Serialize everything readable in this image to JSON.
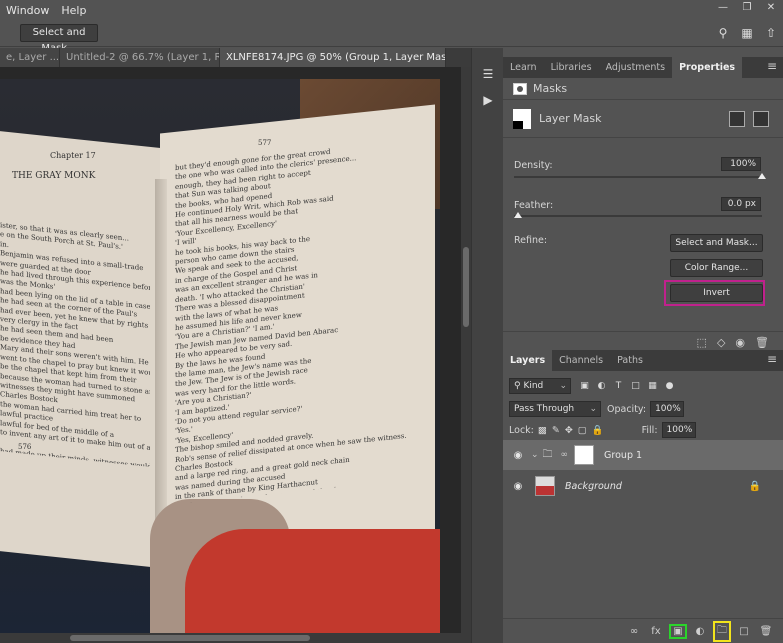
{
  "menu": {
    "items": [
      "Window",
      "Help"
    ]
  },
  "window_controls": {
    "minimize": "—",
    "restore": "❐",
    "close": "✕"
  },
  "options_bar": {
    "select_and_mask_label": "Select and Mask..."
  },
  "tabs": [
    {
      "label": "e, Layer ...",
      "close": "×"
    },
    {
      "label": "Untitled-2 @ 66.7% (Layer 1, RGB...",
      "close": "×"
    },
    {
      "label": "XLNFE8174.JPG @ 50% (Group 1, Layer Mask/8) *",
      "close": "×"
    }
  ],
  "book": {
    "left_chapter": "Chapter 17",
    "left_title": "THE GRAY MONK",
    "left_page_number": "576",
    "right_page_number": "577",
    "left_text": "ister, so that it was as clearly seen...\ne on the South Porch at St. Paul's.'\nin.\nBenjamin was refused into a small-trade\nwere guarded at the door\nhe had lived through this experience before. It\nwas the Monks'\nhad been lying on the lid of a table in case\nhe had seen at the corner of the Paul's\nhad ever been, yet he knew that by rights\nvery clergy in the fact\nhe had seen them and had been\nbe evidence they had\nMary and their sons weren't with him. He\nwent to the chapel to pray but knew it wouldn't\nbe the chapel that kept him from their\nbecause the woman had turned to stone and cast\nwitnesses they might have summoned\nCharles Bostock\nthe woman had carried him treat her to\nlawful practice\nlawful for bed of the middle of a\nto invent any art of it to make him out of an\n\nhad made up their minds, witnesses wouldn't\ncome through the authorities as proof, and they\nlibrary to record the evidence\nthey decided they had found the Jew'\nting favour in the Imam for gaining the",
    "right_text": "but they'd enough gone for the great crowd\nthe one who was called into the clerics' presence...\nenough, they had been right to accept\nthat Sun was talking about\nthe books, who had opened\nHe continued Holy Writ, which Rob was said\nthat all his nearness would be that\n'Your Excellency, Excellency'\n'I will'\nhe took his books, his way back to the\nperson who came down the stairs\nWe speak and seek to the accused,\nin charge of the Gospel and Christ\nwas an excellent stranger and he was in\ndeath. 'I who attacked the Christian'\nThere was a blessed disappointment\nwith the laws of what he was\nhe assumed his life and never knew\n'You are a Christian?' 'I am.'\nThe Jewish man Jew named David ben Abarac\nHe who appeared to be very sad.\nBy the laws he was found\nthe lame man, the Jew's name was the\nthe Jew. The Jew is of the Jewish race\nwas very hard for the little words.\n'Are you a Christian?'\n'I am baptized.'\n'Do not you attend regular service?'\n'Yes.'\n'Yes, Excellency'\nThe bishop smiled and nodded gravely.\nRob's sense of relief dissipated at once when he saw the witness.\nCharles Bostock\nand a large red ring, and a great gold neck chain\nwas named during the accused\nin the rank of thane by King Harthacnut\nservices as a merchant-adventurer, and that he\nSt. Peter's. The witness, Mister Bostock\n'Now then, Master Bostock. Do you know this man?'\n'He is Jesse ben Benjamin, a Jew and a physician,' Bostock said flatly."
  },
  "toolstrip": {
    "icons": [
      "layer-comps-icon",
      "play-icon"
    ]
  },
  "properties_panel": {
    "tabs": [
      "Learn",
      "Libraries",
      "Adjustments",
      "Properties"
    ],
    "active_tab": "Properties",
    "masks_label": "Masks",
    "layer_mask_label": "Layer Mask",
    "density_label": "Density:",
    "density_value": "100%",
    "density_fraction": 1.0,
    "feather_label": "Feather:",
    "feather_value": "0.0 px",
    "feather_fraction": 0.0,
    "refine_label": "Refine:",
    "select_and_mask_button": "Select and Mask...",
    "color_range_button": "Color Range...",
    "invert_button": "Invert",
    "highlight_color": "#c0218d",
    "footer_icons": [
      "load-selection-icon",
      "apply-mask-icon",
      "visibility-icon",
      "delete-icon"
    ]
  },
  "layers_panel": {
    "tabs": [
      "Layers",
      "Channels",
      "Paths"
    ],
    "active_tab": "Layers",
    "filter_label": "Kind",
    "blend_mode": "Pass Through",
    "opacity_label": "Opacity:",
    "opacity_value": "100%",
    "lock_label": "Lock:",
    "fill_label": "Fill:",
    "fill_value": "100%",
    "layers": [
      {
        "name": "Group 1",
        "selected": true,
        "type": "group"
      },
      {
        "name": "Background",
        "selected": false,
        "type": "image",
        "locked": true
      }
    ],
    "footer_icons": [
      "link-icon",
      "fx-icon",
      "add-mask-icon",
      "adjustment-icon",
      "new-group-icon",
      "new-layer-icon",
      "trash-icon"
    ],
    "footer_labels": {
      "fx": "fx"
    },
    "highlight_green": "#2bd42b",
    "highlight_yellow": "#f2e41c"
  }
}
